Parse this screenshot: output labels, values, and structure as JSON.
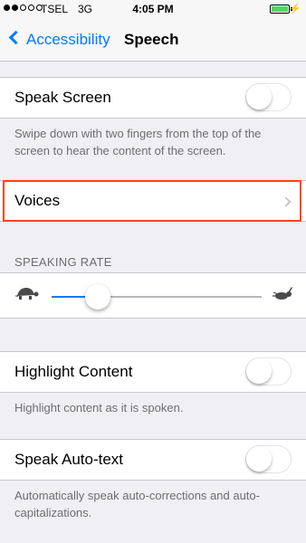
{
  "status_bar": {
    "carrier": "TSEL",
    "network": "3G",
    "time": "4:05 PM",
    "signal_bars_filled": 2,
    "signal_bars_total": 5
  },
  "nav": {
    "back_label": "Accessibility",
    "title": "Speech"
  },
  "speak_screen": {
    "label": "Speak Screen",
    "enabled": false,
    "footer": "Swipe down with two fingers from the top of the screen to hear the content of the screen."
  },
  "voices": {
    "label": "Voices"
  },
  "speaking_rate": {
    "header": "SPEAKING RATE",
    "value_fraction": 0.21,
    "min_icon": "turtle-icon",
    "max_icon": "hare-icon"
  },
  "highlight_content": {
    "label": "Highlight Content",
    "enabled": false,
    "footer": "Highlight content as it is spoken."
  },
  "speak_auto_text": {
    "label": "Speak Auto-text",
    "enabled": false,
    "footer": "Automatically speak auto-corrections and auto-capitalizations."
  },
  "colors": {
    "accent": "#007aff",
    "highlight_border": "#ff4500",
    "background": "#efeff4"
  }
}
